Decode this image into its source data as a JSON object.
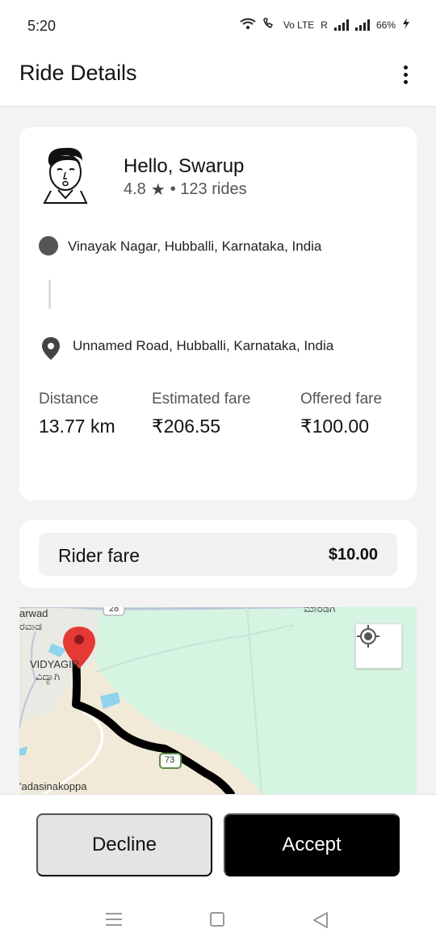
{
  "status_bar": {
    "time": "5:20",
    "network_label": "Vo LTE",
    "sim_label": "R",
    "battery": "66%"
  },
  "app_bar": {
    "title": "Ride Details",
    "more_icon": "more-vert-icon"
  },
  "rider": {
    "greeting": "Hello, Swarup",
    "rating": "4.8",
    "rides": "• 123 rides",
    "avatar_icon": "cartoon-face-avatar"
  },
  "route": {
    "pickup": "Vinayak Nagar, Hubballi, Karnataka, India",
    "drop": "Unnamed Road, Hubballi, Karnataka, India"
  },
  "stats": [
    {
      "label": "Distance",
      "value": "13.77 km"
    },
    {
      "label": "Estimated fare",
      "value": "₹206.55"
    },
    {
      "label": "Offered fare",
      "value": "₹100.00"
    }
  ],
  "fare": {
    "label": "Rider fare",
    "value": "$10.00"
  },
  "map": {
    "labels": {
      "top_left_1": "arwad",
      "top_left_2": "ರವಾಡ",
      "vidyagiri": "VIDYAGIR",
      "vidyagiri_kn": "ವಿದ್ಯಾಗಿ",
      "bottom_left": "'adasinakoppa",
      "top_right": "ಮಾರಡಗಿ",
      "route_28": "28",
      "route_73": "73"
    },
    "colors": {
      "park": "#d5f4e2",
      "land": "#f2ead9",
      "water": "#8fd3ec",
      "route": "#000000",
      "pin": "#e53935"
    }
  },
  "actions": {
    "decline": "Decline",
    "accept": "Accept"
  },
  "colors": {
    "accent": "#000000",
    "background": "#f3f3f3"
  }
}
